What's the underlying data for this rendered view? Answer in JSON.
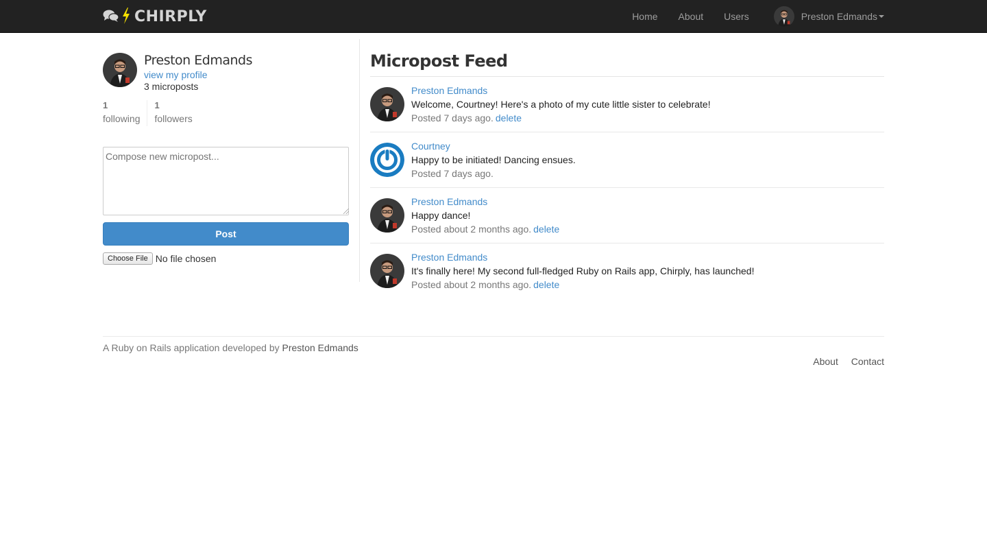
{
  "navbar": {
    "brand": "CHIRPLY",
    "links": [
      "Home",
      "About",
      "Users"
    ],
    "user_name": "Preston Edmands"
  },
  "sidebar": {
    "user_name": "Preston Edmands",
    "profile_link": "view my profile",
    "micropost_count": "3 microposts",
    "stats": [
      {
        "value": "1",
        "label": "following"
      },
      {
        "value": "1",
        "label": "followers"
      }
    ],
    "compose_placeholder": "Compose new micropost...",
    "post_button": "Post",
    "file_button": "Choose File",
    "file_status": "No file chosen"
  },
  "feed": {
    "title": "Micropost Feed",
    "items": [
      {
        "user": "Preston Edmands",
        "content": "Welcome, Courtney! Here's a photo of my cute little sister to celebrate!",
        "timestamp": "Posted 7 days ago.",
        "delete": "delete"
      },
      {
        "user": "Courtney",
        "content": "Happy to be initiated! Dancing ensues.",
        "timestamp": "Posted 7 days ago.",
        "delete": ""
      },
      {
        "user": "Preston Edmands",
        "content": "Happy dance!",
        "timestamp": "Posted about 2 months ago.",
        "delete": "delete"
      },
      {
        "user": "Preston Edmands",
        "content": "It's finally here! My second full-fledged Ruby on Rails app, Chirply, has launched!",
        "timestamp": "Posted about 2 months ago.",
        "delete": "delete"
      }
    ]
  },
  "footer": {
    "credit_prefix": "A Ruby on Rails application developed by",
    "author": "Preston Edmands",
    "links": [
      "About",
      "Contact"
    ]
  },
  "colors": {
    "navbar_bg": "#222222",
    "link": "#428bca",
    "brand_bolt": "#f5e000",
    "courtney_avatar": "#1a7cc1"
  }
}
